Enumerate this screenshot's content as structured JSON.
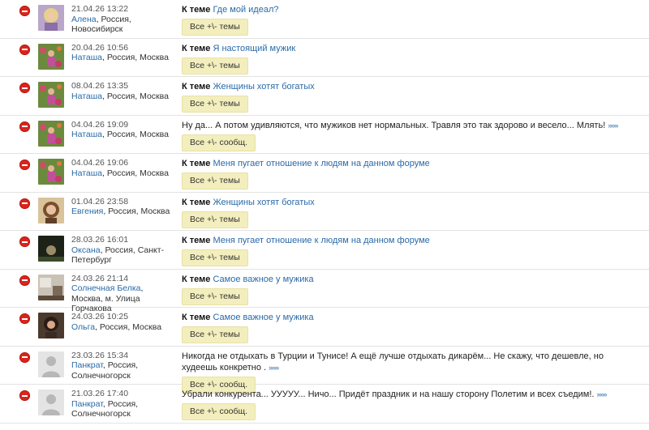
{
  "rows": [
    {
      "date": "21.04.26 13:22",
      "name": "Алена",
      "loc": ", Россия, Новосибирск",
      "kind": "topic",
      "topic_label": "К теме",
      "topic": "Где мой идеал?",
      "button": "Все +\\- темы",
      "avatar": "woman-blonde"
    },
    {
      "date": "20.04.26 10:56",
      "name": "Наташа",
      "loc": ", Россия, Москва",
      "kind": "topic",
      "topic_label": "К теме",
      "topic": "Я настоящий мужик",
      "button": "Все +\\- темы",
      "avatar": "woman-flowers"
    },
    {
      "date": "08.04.26 13:35",
      "name": "Наташа",
      "loc": ", Россия, Москва",
      "kind": "topic",
      "topic_label": "К теме",
      "topic": "Женщины хотят богатых",
      "button": "Все +\\- темы",
      "avatar": "woman-flowers"
    },
    {
      "date": "04.04.26 19:09",
      "name": "Наташа",
      "loc": ", Россия, Москва",
      "kind": "msg",
      "text": "Ну да... А потом удивляются, что мужиков нет нормальных. Травля это так здорово и весело... Млять!",
      "more": "»»»",
      "button": "Все +\\- сообщ.",
      "avatar": "woman-flowers"
    },
    {
      "date": "04.04.26 19:06",
      "name": "Наташа",
      "loc": ", Россия, Москва",
      "kind": "topic",
      "topic_label": "К теме",
      "topic": "Меня пугает отношение к людям на данном форуме",
      "button": "Все +\\- темы",
      "avatar": "woman-flowers"
    },
    {
      "date": "01.04.26 23:58",
      "name": "Евгения",
      "loc": ", Россия, Москва",
      "kind": "topic",
      "topic_label": "К теме",
      "topic": "Женщины хотят богатых",
      "button": "Все +\\- темы",
      "avatar": "woman-portrait"
    },
    {
      "date": "28.03.26 16:01",
      "name": "Оксана",
      "loc": ", Россия, Санкт-Петербург",
      "kind": "topic",
      "topic_label": "К теме",
      "topic": "Меня пугает отношение к людям на данном форуме",
      "button": "Все +\\- темы",
      "avatar": "dark-photo"
    },
    {
      "date": "24.03.26 21:14",
      "name": "Солнечная Белка",
      "loc": ", Москва, м. Улица Горчакова",
      "kind": "topic",
      "topic_label": "К теме",
      "topic": "Самое важное у мужика",
      "button": "Все +\\- темы",
      "avatar": "interior"
    },
    {
      "date": "24.03.26 10:25",
      "name": "Ольга",
      "loc": ", Россия, Москва",
      "kind": "topic",
      "topic_label": "К теме",
      "topic": "Самое важное у мужика",
      "button": "Все +\\- темы",
      "avatar": "woman-dark"
    },
    {
      "date": "23.03.26 15:34",
      "name": "Панкрат",
      "loc": ", Россия, Солнечногорск",
      "kind": "msg",
      "text": "Никогда не отдыхать в Турции и Тунисе! А ещё лучше отдыхать дикарём... Не скажу, что дешевле, но худеешь конкретно .",
      "more": "»»»",
      "button": "Все +\\- сообщ.",
      "avatar": "placeholder"
    },
    {
      "date": "21.03.26 17:40",
      "name": "Панкрат",
      "loc": ", Россия, Солнечногорск",
      "kind": "msg",
      "text": "Убрали конкурента... УУУУУ... Ничо... Придёт праздник и на нашу сторону Полетим и всех съедим!.",
      "more": "»»»",
      "button": "Все +\\- сообщ.",
      "avatar": "placeholder"
    }
  ]
}
